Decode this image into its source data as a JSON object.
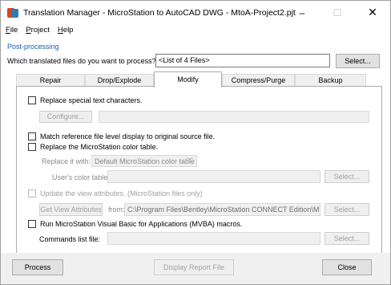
{
  "window": {
    "title": "Translation Manager - MicroStation to AutoCAD DWG - MtoA-Project2.pjt",
    "controls": {
      "minimize": "–",
      "maximize": "☐",
      "close": "✕"
    }
  },
  "menubar": {
    "items": [
      {
        "label_u": "F",
        "label_rest": "ile"
      },
      {
        "label_u": "P",
        "label_rest": "roject"
      },
      {
        "label_u": "H",
        "label_rest": "elp"
      }
    ]
  },
  "section_label": "Post-processing",
  "files_question": {
    "label": "Which translated files do you want to process?",
    "value": "<List of 4 Files>",
    "select_label": "Select..."
  },
  "tabs": [
    {
      "label": "Repair",
      "active": false
    },
    {
      "label": "Drop/Explode",
      "active": false
    },
    {
      "label": "Modify",
      "active": true
    },
    {
      "label": "Compress/Purge",
      "active": false
    },
    {
      "label": "Backup",
      "active": false
    }
  ],
  "modify": {
    "replace_special_text": {
      "label": "Replace special text characters.",
      "checked": false
    },
    "configure_label": "Configure...",
    "configure_value": "",
    "match_ref_level": {
      "label": "Match reference file level display to original source file.",
      "checked": false
    },
    "replace_color_table": {
      "label": "Replace the MicroStation color table.",
      "checked": false
    },
    "replace_it_with_label": "Replace it with:",
    "replace_it_with_value": "Default MicroStation color table",
    "users_color_table_label": "User's color table:",
    "users_color_table_value": "",
    "users_color_table_select": "Select...",
    "update_view_attr": {
      "label": "Update the view attributes. (MicroStation files only)",
      "checked": false
    },
    "get_view_attr_label": "Get View Attributes",
    "from_label": "from:",
    "from_value": "C:\\Program Files\\Bentley\\MicroStation CONNECT Edition\\MicroSta",
    "from_select": "Select...",
    "run_mvba": {
      "label": "Run MicroStation Visual Basic for Applications (MVBA) macros.",
      "checked": false
    },
    "commands_list_label": "Commands list file:",
    "commands_list_value": "",
    "commands_list_select": "Select..."
  },
  "buttons": {
    "process": "Process",
    "display_report": "Display Report File",
    "close": "Close"
  }
}
